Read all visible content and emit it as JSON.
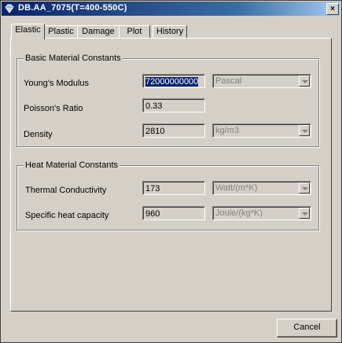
{
  "window": {
    "title": "DB.AA_7075(T=400-550C)",
    "close_label": "×"
  },
  "tabs": [
    {
      "label": "Elastic",
      "active": true
    },
    {
      "label": "Plastic",
      "active": false
    },
    {
      "label": "Damage",
      "active": false
    },
    {
      "label": "Plot",
      "active": false
    },
    {
      "label": "History",
      "active": false
    }
  ],
  "basic": {
    "title": "Basic Material Constants",
    "youngs": {
      "label": "Young's Modulus",
      "value": "72000000000",
      "unit": "Pascal"
    },
    "poisson": {
      "label": "Poisson's Ratio",
      "value": "0.33"
    },
    "density": {
      "label": "Density",
      "value": "2810",
      "unit": "kg/m3"
    }
  },
  "heat": {
    "title": "Heat Material Constants",
    "conductivity": {
      "label": "Thermal Conductivity",
      "value": "173",
      "unit": "Watt/(m*K)"
    },
    "specific_heat": {
      "label": "Specific heat capacity",
      "value": "960",
      "unit": "Joule/(kg*K)"
    }
  },
  "footer": {
    "cancel_label": "Cancel"
  }
}
